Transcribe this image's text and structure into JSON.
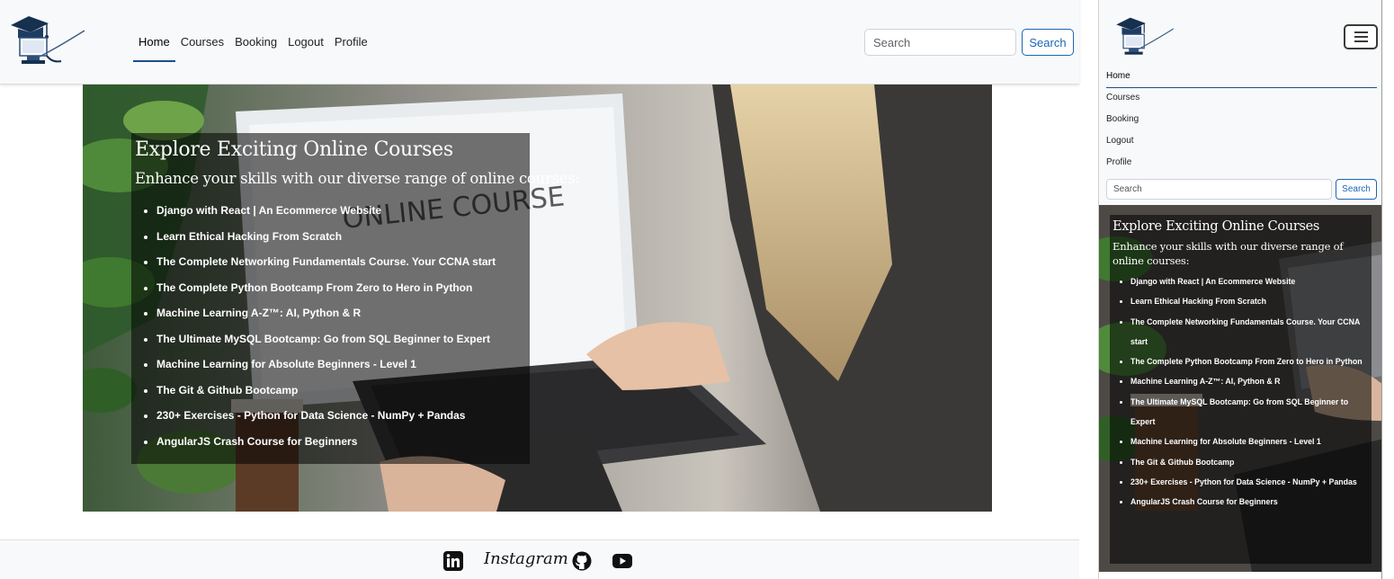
{
  "nav": {
    "links": [
      "Home",
      "Courses",
      "Booking",
      "Logout",
      "Profile"
    ],
    "active": "Home",
    "search_placeholder": "Search",
    "search_button": "Search"
  },
  "hero": {
    "title": "Explore Exciting Online Courses",
    "subtitle": "Enhance your skills with our diverse range of online courses:",
    "image_text": "ONLINE COURSE",
    "courses": [
      "Django with React | An Ecommerce Website",
      "Learn Ethical Hacking From Scratch",
      "The Complete Networking Fundamentals Course. Your CCNA start",
      "The Complete Python Bootcamp From Zero to Hero in Python",
      "Machine Learning A-Z™: AI, Python & R",
      "The Ultimate MySQL Bootcamp: Go from SQL Beginner to Expert",
      "Machine Learning for Absolute Beginners - Level 1",
      "The Git & Github Bootcamp",
      "230+ Exercises - Python for Data Science - NumPy + Pandas",
      "AngularJS Crash Course for Beginners"
    ]
  },
  "footer": {
    "instagram_label": "Instagram",
    "icons": [
      "linkedin-icon",
      "instagram-icon",
      "github-icon",
      "youtube-icon"
    ]
  },
  "colors": {
    "navbar_bg": "#f8f9fa",
    "primary": "#1a66b5",
    "overlay": "rgba(0,0,0,0.55)"
  }
}
